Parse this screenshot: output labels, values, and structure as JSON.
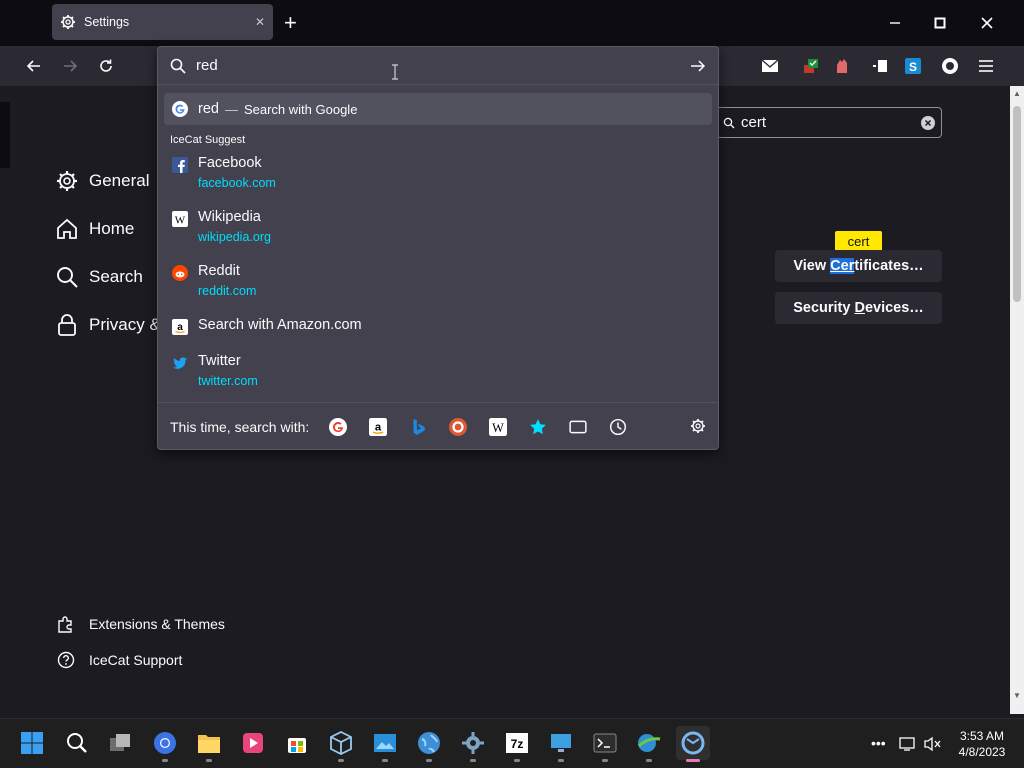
{
  "tab": {
    "title": "Settings",
    "close": "✕",
    "new": "+"
  },
  "window_controls": {
    "minimize": "—",
    "maximize": "☐",
    "close": "✕"
  },
  "urlbar": {
    "value": "red"
  },
  "dropdown": {
    "heuristic": {
      "query": "red",
      "separator": "—",
      "action": "Search with Google"
    },
    "section_label": "IceCat Suggest",
    "suggestions": [
      {
        "title": "Facebook",
        "url": "facebook.com",
        "icon": "facebook-icon"
      },
      {
        "title": "Wikipedia",
        "url": "wikipedia.org",
        "icon": "wikipedia-icon"
      },
      {
        "title": "Reddit",
        "url": "reddit.com",
        "icon": "reddit-icon"
      },
      {
        "title": "Search with Amazon.com",
        "url": "",
        "icon": "amazon-icon"
      },
      {
        "title": "Twitter",
        "url": "twitter.com",
        "icon": "twitter-icon"
      }
    ],
    "one_off_label": "This time, search with:"
  },
  "settings": {
    "categories": [
      "General",
      "Home",
      "Search",
      "Privacy &"
    ],
    "find_value": "cert",
    "tooltip": "cert",
    "view_certs": {
      "pre": "View ",
      "match": "Cer",
      "rest": "tificates…"
    },
    "security_devices": {
      "pre": "Security ",
      "ul": "D",
      "rest": "evices…"
    },
    "footer": [
      "Extensions & Themes",
      "IceCat Support"
    ]
  },
  "clock": {
    "time": "3:53 AM",
    "date": "4/8/2023"
  },
  "colors": {
    "accent": "#00ddff",
    "tooltip": "#ffe900",
    "panel": "#42414d",
    "highlight": "#52525e"
  }
}
